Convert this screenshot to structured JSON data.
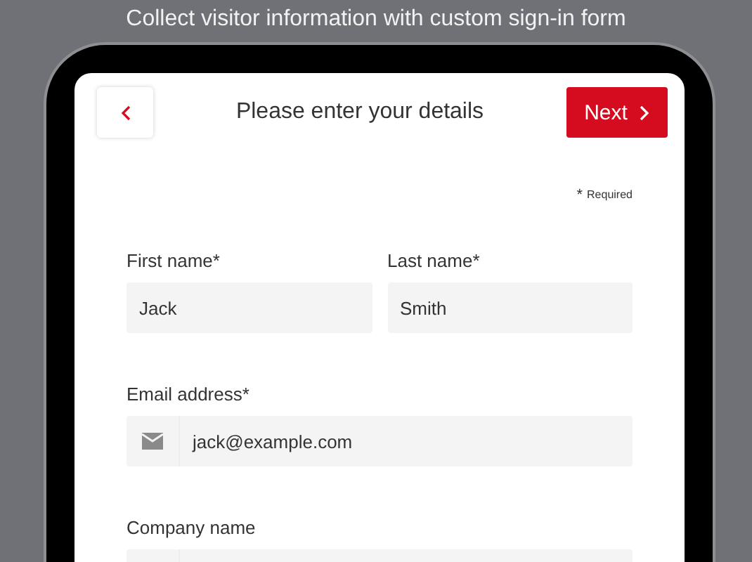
{
  "caption": "Collect visitor information with custom sign-in form",
  "header": {
    "title": "Please enter your details",
    "next_button": "Next"
  },
  "required_note": {
    "mark": "*",
    "text": "Required"
  },
  "fields": [
    {
      "kind": "text",
      "label": "First name*",
      "value": "Jack"
    },
    {
      "kind": "text",
      "label": "Last name*",
      "value": "Smith"
    },
    {
      "kind": "email",
      "label": "Email address*",
      "value": "jack@example.com"
    },
    {
      "kind": "company",
      "label": "Company name"
    }
  ]
}
